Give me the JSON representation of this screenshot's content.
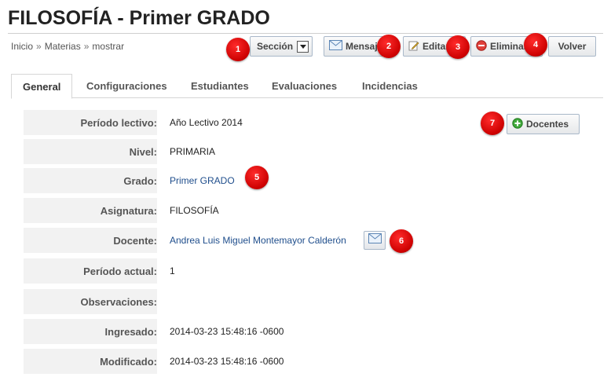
{
  "header": {
    "title": "FILOSOFÍA - Primer GRADO"
  },
  "breadcrumb": [
    "Inicio",
    "Materias",
    "mostrar"
  ],
  "breadcrumb_sep": "»",
  "toolbar": {
    "seccion_label": "Sección",
    "mensaje_label": "Mensaje",
    "editar_label": "Editar",
    "eliminar_label": "Eliminar",
    "volver_label": "Volver"
  },
  "tabs": [
    "General",
    "Configuraciones",
    "Estudiantes",
    "Evaluaciones",
    "Incidencias"
  ],
  "docentes_button": "Docentes",
  "fields": [
    {
      "label": "Período lectivo:",
      "value": "Año Lectivo 2014"
    },
    {
      "label": "Nivel:",
      "value": "PRIMARIA"
    },
    {
      "label": "Grado:",
      "value": "Primer GRADO"
    },
    {
      "label": "Asignatura:",
      "value": "FILOSOFÍA"
    },
    {
      "label": "Docente:",
      "value": "Andrea Luis Miguel Montemayor Calderón"
    },
    {
      "label": "Período actual:",
      "value": "1"
    },
    {
      "label": "Observaciones:",
      "value": ""
    },
    {
      "label": "Ingresado:",
      "value": "2014-03-23 15:48:16 -0600"
    },
    {
      "label": "Modificado:",
      "value": "2014-03-23 15:48:16 -0600"
    }
  ],
  "badges": [
    "1",
    "2",
    "3",
    "4",
    "5",
    "6",
    "7"
  ],
  "colors": {
    "accent_link": "#1f4e8c",
    "badge": "#cc0000"
  },
  "icons": {
    "seccion": "dropdown-arrow-icon",
    "mensaje": "envelope-icon",
    "editar": "pencil-icon",
    "eliminar": "delete-circle-icon",
    "docentes": "add-green-icon",
    "docente_mail": "envelope-icon"
  }
}
